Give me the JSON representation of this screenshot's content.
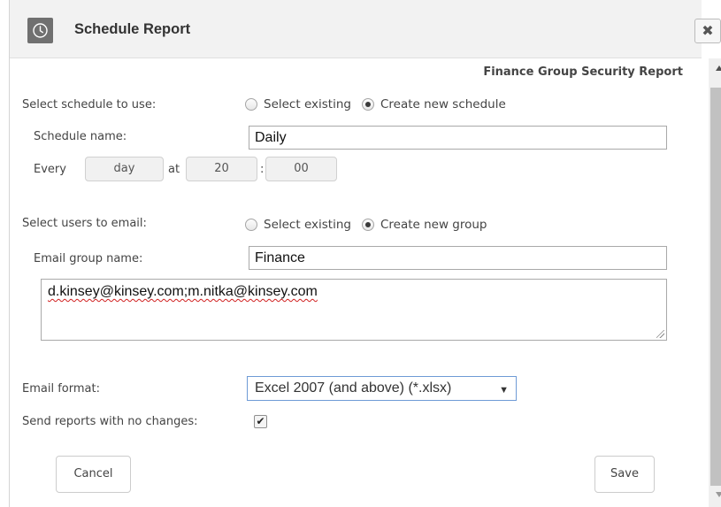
{
  "dialog": {
    "title": "Schedule Report",
    "close_label": "✖",
    "report_name": "Finance Group Security Report"
  },
  "schedule": {
    "label": "Select schedule to use:",
    "option_existing": "Select existing",
    "option_new": "Create new schedule",
    "selected": "Create new schedule",
    "name_label": "Schedule name:",
    "name_value": "Daily",
    "every_label": "Every",
    "every_value": "day",
    "at_label": "at",
    "hour": "20",
    "colon": ":",
    "minute": "00"
  },
  "users": {
    "label": "Select users to email:",
    "option_existing": "Select existing",
    "option_new": "Create new group",
    "selected": "Create new group",
    "group_label": "Email group name:",
    "group_value": "Finance",
    "emails": "d.kinsey@kinsey.com;m.nitka@kinsey.com"
  },
  "format": {
    "label": "Email format:",
    "selected": "Excel 2007 (and above) (*.xlsx)"
  },
  "no_changes": {
    "label": "Send reports with no changes:",
    "checked": true
  },
  "buttons": {
    "cancel": "Cancel",
    "save": "Save"
  },
  "icons": {
    "header": "clock-icon",
    "close": "close-icon",
    "select": "dropdown-arrow-icon",
    "check": "checkmark-icon"
  }
}
